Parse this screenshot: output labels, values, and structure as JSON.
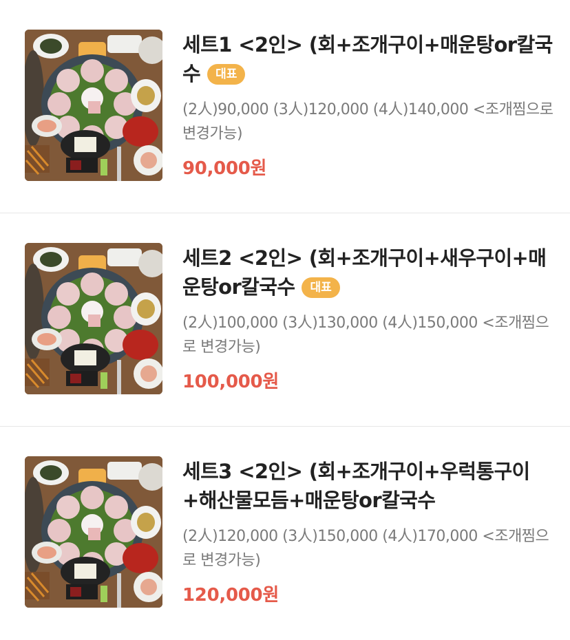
{
  "menu": {
    "items": [
      {
        "title": "세트1 <2인> (회+조개구이+매운탕or칼국수",
        "badge": "대표",
        "description": "(2人)90,000 (3人)120,000 (4人)140,000 <조개찜으로 변경가능)",
        "price": "90,000원",
        "image_icon": "seafood-platter-photo"
      },
      {
        "title": "세트2 <2인> (회+조개구이+새우구이+매운탕or칼국수",
        "badge": "대표",
        "description": "(2人)100,000 (3人)130,000 (4人)150,000 <조개찜으로 변경가능)",
        "price": "100,000원",
        "image_icon": "seafood-platter-photo"
      },
      {
        "title": "세트3 <2인> (회+조개구이+우럭통구이+해산물모듬+매운탕or칼국수",
        "badge": "",
        "description": "(2人)120,000 (3人)150,000 (4人)170,000 <조개찜으로 변경가능)",
        "price": "120,000원",
        "image_icon": "seafood-platter-photo"
      }
    ]
  },
  "colors": {
    "badge": "#f3b34a",
    "price": "#e55a4a",
    "title": "#222222",
    "description": "#7a7a7a"
  }
}
